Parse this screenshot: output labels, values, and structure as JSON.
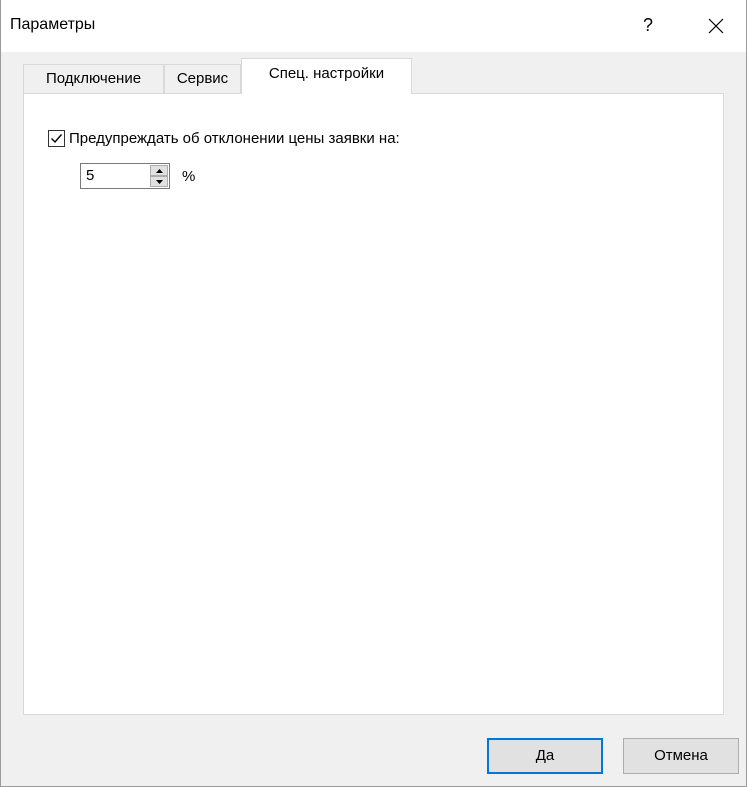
{
  "window": {
    "title": "Параметры",
    "help_label": "?",
    "close_icon": "close-icon"
  },
  "tabs": [
    {
      "label": "Подключение",
      "active": false
    },
    {
      "label": "Сервис",
      "active": false
    },
    {
      "label": "Спец. настройки",
      "active": true
    }
  ],
  "panel": {
    "price_warning": {
      "checked": true,
      "label": "Предупреждать об отклонении цены заявки на:"
    },
    "deviation": {
      "value": "5",
      "unit": "%"
    }
  },
  "buttons": {
    "ok_label": "Да",
    "cancel_label": "Отмена"
  },
  "colors": {
    "accent": "#0078d7",
    "background": "#f0f0f0",
    "panel": "#ffffff"
  }
}
